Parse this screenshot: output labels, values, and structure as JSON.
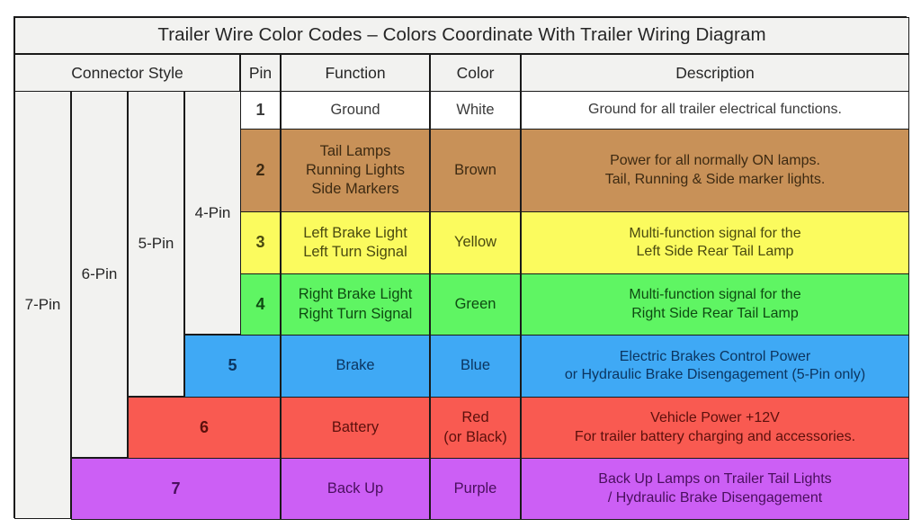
{
  "table": {
    "title": "Trailer Wire Color Codes  –  Colors Coordinate With Trailer Wiring Diagram",
    "headers": {
      "connector_style": "Connector Style",
      "pin": "Pin",
      "function": "Function",
      "color": "Color",
      "description": "Description"
    },
    "connector_styles": [
      {
        "label": "7-Pin"
      },
      {
        "label": "6-Pin"
      },
      {
        "label": "5-Pin"
      },
      {
        "label": "4-Pin"
      }
    ],
    "rows": [
      {
        "pin": "1",
        "function": "Ground",
        "color": "White",
        "description": "Ground for all trailer electrical functions.",
        "swatch_hex": "#ffffff",
        "text_hex": "#3a3a3a"
      },
      {
        "pin": "2",
        "function": "Tail Lamps\nRunning Lights\nSide Markers",
        "color": "Brown",
        "description": "Power for all normally ON lamps.\nTail, Running & Side marker lights.",
        "swatch_hex": "#c89158",
        "text_hex": "#3d2a12"
      },
      {
        "pin": "3",
        "function": "Left Brake Light\nLeft Turn Signal",
        "color": "Yellow",
        "description": "Multi-function signal for the\nLeft Side Rear Tail Lamp",
        "swatch_hex": "#fbfb5e",
        "text_hex": "#4a4a10"
      },
      {
        "pin": "4",
        "function": "Right Brake Light\nRight Turn Signal",
        "color": "Green",
        "description": "Multi-function signal for the\nRight Side Rear Tail Lamp",
        "swatch_hex": "#5ff563",
        "text_hex": "#0e4a12"
      },
      {
        "pin": "5",
        "function": "Brake",
        "color": "Blue",
        "description": "Electric Brakes Control Power\nor Hydraulic Brake Disengagement (5-Pin only)",
        "swatch_hex": "#3fa9f5",
        "text_hex": "#0c3560"
      },
      {
        "pin": "6",
        "function": "Battery",
        "color": "Red\n(or Black)",
        "description": "Vehicle Power +12V\nFor trailer battery charging and accessories.",
        "swatch_hex": "#f95a51",
        "text_hex": "#5c100c"
      },
      {
        "pin": "7",
        "function": "Back Up",
        "color": "Purple",
        "description": "Back Up Lamps on Trailer Tail Lights\n/ Hydraulic Brake Disengagement",
        "swatch_hex": "#cc5ff5",
        "text_hex": "#4a0f5e"
      }
    ]
  }
}
